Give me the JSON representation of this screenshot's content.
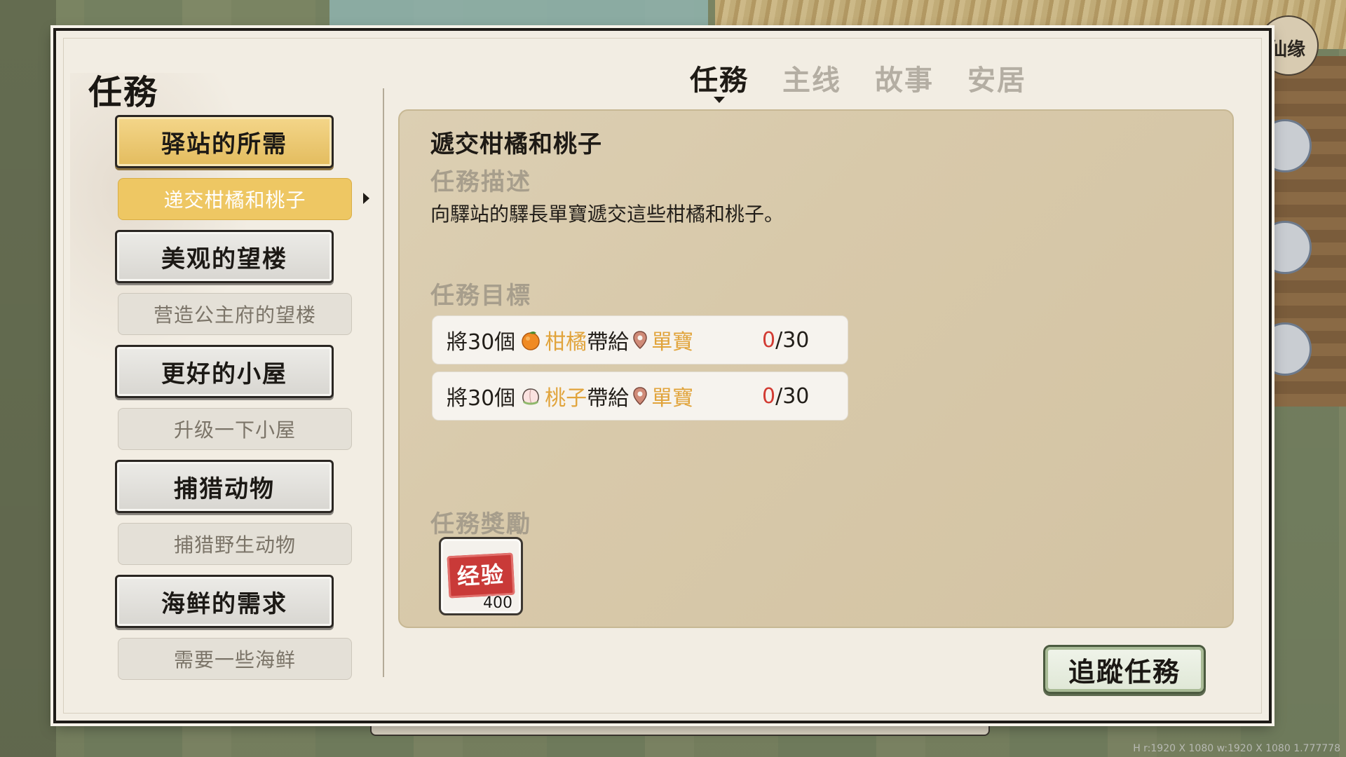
{
  "screen_info": "H r:1920 X 1080 w:1920 X 1080 1.777778",
  "corner_badge": "仙缘",
  "panel": {
    "title": "任務"
  },
  "tabs": [
    {
      "label": "任務",
      "active": true
    },
    {
      "label": "主线",
      "active": false
    },
    {
      "label": "故事",
      "active": false
    },
    {
      "label": "安居",
      "active": false
    }
  ],
  "quest_groups": [
    {
      "title": "驿站的所需",
      "active": true,
      "sub": "递交柑橘和桃子",
      "sub_active": true
    },
    {
      "title": "美观的望楼",
      "active": false,
      "sub": "营造公主府的望楼",
      "sub_active": false
    },
    {
      "title": "更好的小屋",
      "active": false,
      "sub": "升级一下小屋",
      "sub_active": false
    },
    {
      "title": "捕猎动物",
      "active": false,
      "sub": "捕猎野生动物",
      "sub_active": false
    },
    {
      "title": "海鲜的需求",
      "active": false,
      "sub": "需要一些海鲜",
      "sub_active": false
    }
  ],
  "detail": {
    "title": "遞交柑橘和桃子",
    "description_label": "任務描述",
    "description": "向驛站的驛長單寶遞交這些柑橘和桃子。",
    "objectives_label": "任務目標",
    "objectives": [
      {
        "prefix": "將30個",
        "fruit_icon": "orange-icon",
        "item": "柑橘",
        "verb": "帶給",
        "npc": "單寶",
        "current": "0",
        "total": "/30"
      },
      {
        "prefix": "將30個",
        "fruit_icon": "peach-icon",
        "item": "桃子",
        "verb": "帶給",
        "npc": "單寶",
        "current": "0",
        "total": "/30"
      }
    ],
    "rewards_label": "任務獎勵",
    "reward": {
      "stamp": "经验",
      "count": "400",
      "icon": "experience-stamp-icon"
    }
  },
  "track_button": "追蹤任務",
  "colors": {
    "highlight_gold": "#eec763",
    "objective_orange": "#e1a43c",
    "progress_red": "#d23b33",
    "card_bg": "#d8c9aa"
  }
}
